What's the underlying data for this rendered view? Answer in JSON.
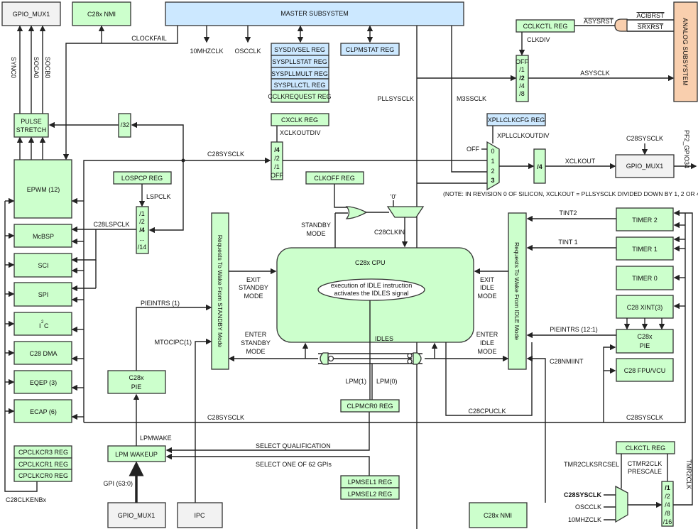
{
  "colors": {
    "green": "#ccffcc",
    "blue": "#cce8ff",
    "gray": "#f2f2f2",
    "analog": "#f9cfae"
  },
  "blocks": {
    "gpio_mux1_top": "GPIO_MUX1",
    "c28x_nmi_top": "C28x NMI",
    "master_subsystem": "MASTER SUBSYSTEM",
    "pulse_stretch_1": "PULSE",
    "pulse_stretch_2": "STRETCH",
    "div32": "/32",
    "epwm": "EPWM  (12)",
    "mcbsp": "McBSP",
    "sci": "SCI",
    "spi": "SPI",
    "i2c": "I",
    "i2c_sup": "2",
    "i2c_c": "C",
    "c28_dma": "C28 DMA",
    "eqep": "EQEP  (3)",
    "ecap": "ECAP  (6)",
    "cpclkcr3": "CPCLKCR3  REG",
    "cpclkcr1": "CPCLKCR1  REG",
    "cpclkcr0": "CPCLKCR0  REG",
    "c28x_pie_left_1": "C28x",
    "c28x_pie_left_2": "PIE",
    "lpm_wakeup": "LPM WAKEUP",
    "gpio_mux1_bottom": "GPIO_MUX1",
    "ipc": "IPC",
    "standby_bar": "Requests To Wake From STANDBY Mode",
    "idle_bar": "Requests To Wake From IDLE Mode",
    "sysdivsel": "SYSDIVSEL  REG",
    "syspllstat": "SYSPLLSTAT  REG",
    "syspllmult": "SYSPLLMULT  REG",
    "sysplllctl": "SYSPLLCTL  REG",
    "cclkrequest": "CCLKREQUEST REG",
    "clpmstat": "CLPMSTAT  REG",
    "cxclk": "CXCLK   REG",
    "losp": "LOSPCP REG",
    "clkoff": "CLKOFF  REG",
    "cpu": "C28x  CPU",
    "cpu_note_1": "execution of IDLE instruction",
    "cpu_note_2": "activates the IDLES signal",
    "clpmcr0": "CLPMCR0  REG",
    "lpmsel1": "LPMSEL1 REG",
    "lpmsel2": "LPMSEL2 REG",
    "timer2": "TIMER 2",
    "timer1": "TIMER 1",
    "timer0": "TIMER 0",
    "xint": "C28 XINT(3)",
    "c28x_pie_right_1": "C28x",
    "c28x_pie_right_2": "PIE",
    "fpu": "C28 FPU/VCU",
    "c28x_nmi_bottom": "C28x NMI",
    "clkctl": "CLKCTL REG",
    "cclkctl": "CCLKCTL REG",
    "analog": "ANALOG SUBSYSTEM",
    "xpllclkcfg": "XPLLCLKCFG REG",
    "gpio_mux1_right": "GPIO_MUX1",
    "div4_xclk": "/4"
  },
  "dividers": {
    "xclkoutdiv": [
      "/4",
      "/2",
      "/1",
      "OFF"
    ],
    "lspclk": [
      "/1",
      "/2",
      "/4",
      "...",
      "/14"
    ],
    "clkdiv": [
      "OFF",
      "/1",
      "/2",
      "/4",
      "/8"
    ],
    "xpll_mux": [
      "0",
      "1",
      "2",
      "3"
    ],
    "tmr2": [
      "/1",
      "/2",
      "/4",
      "/8",
      "/16"
    ]
  },
  "signals": {
    "sync0": "SYNC0",
    "soca0": "SOCA0",
    "socb0": "SOCB0",
    "clockfail": "CLOCKFAIL",
    "mhz10": "10MHZCLK",
    "oscclk": "OSCCLK",
    "pllsysclk": "PLLSYSCLK",
    "m3ssclk": "M3SSCLK",
    "xclkoutdiv": "XCLKOUTDIV",
    "c28sysclk_top": "C28SYSCLK",
    "lspclk": "LSPCLK",
    "c28lspclk": "C28LSPCLK",
    "standby_mode_1": "STANDBY",
    "standby_mode_2": "MODE",
    "zero": "'0'",
    "c28clkin": "C28CLKIN",
    "exit_standby_1": "EXIT",
    "exit_standby_2": "STANDBY",
    "exit_standby_3": "MODE",
    "enter_standby_1": "ENTER",
    "enter_standby_2": "STANDBY",
    "enter_standby_3": "MODE",
    "exit_idle_1": "EXIT",
    "exit_idle_2": "IDLE",
    "exit_idle_3": "MODE",
    "enter_idle_1": "ENTER",
    "enter_idle_2": "IDLE",
    "enter_idle_3": "MODE",
    "pieintrs1": "PIEINTRS (1)",
    "mtocipc": "MTOCIPC(1)",
    "idles": "IDLES",
    "lpm1": "LPM(1)",
    "lpm0": "LPM(0)",
    "c28sysclk_mid": "C28SYSCLK",
    "c28cpuclk": "C28CPUCLK",
    "c28sysclk_right": "C28SYSCLK",
    "lpmwake": "LPMWAKE",
    "select_qual": "SELECT QUALIFICATION",
    "select_gpi": "SELECT ONE OF 62 GPIs",
    "gpi": "GPI (63:0)",
    "c28clkenbx": "C28CLKENBx",
    "tint2": "TINT2",
    "tint1": "TINT 1",
    "pieintrs12": "PIEINTRS (12:1)",
    "c28nmiint": "C28NMIINT",
    "tmr2clksrcsel": "TMR2CLKSRCSEL",
    "ctmr2clk_1": "CTMR2CLK",
    "ctmr2clk_2": "PRESCALE",
    "tmr2clk": "TMR2CLK",
    "mux_c28sysclk": "C28SYSCLK",
    "mux_oscclk": "OSCCLK",
    "mux_10mhz": "10MHZCLK",
    "clkdiv": "CLKDIV",
    "asysclk": "ASYSCLK",
    "asysrst": "ASYSRST",
    "acibrst": "ACIBRST",
    "srxrst": "SRXRST",
    "xpllclkoutdiv": "XPLLCLKOUTDIV",
    "off": "OFF",
    "xclkout": "XCLKOUT",
    "c28sysclk_gpio": "C28SYSCLK",
    "pf2": "PF2_GPIO34",
    "note": "(NOTE: IN REVISION 0 OF SILICON, XCLKOUT = PLLSYSCLK DIVIDED DOWN BY 1, 2 OR 4)"
  }
}
